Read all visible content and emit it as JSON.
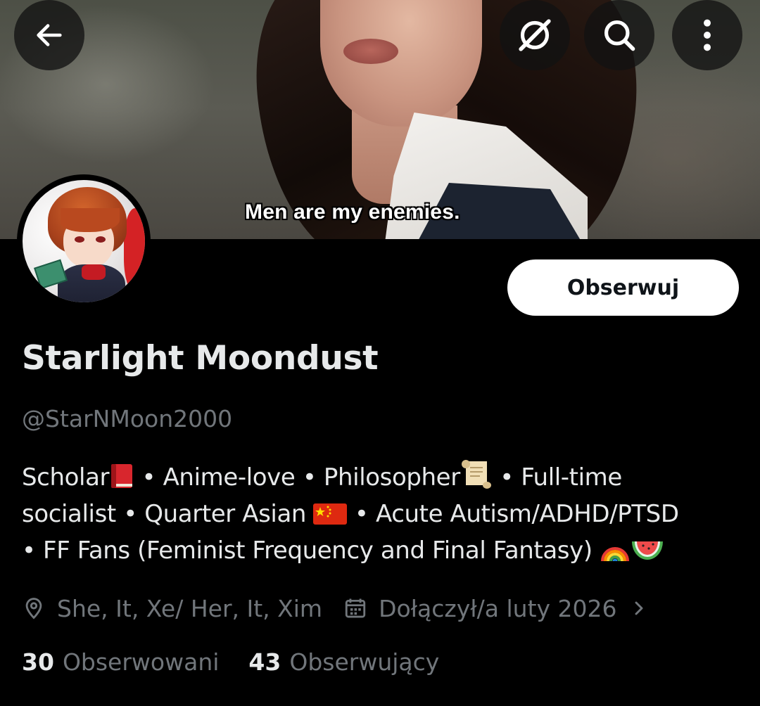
{
  "banner": {
    "caption": "Men are my enemies."
  },
  "top_bar": {
    "back_icon": "arrow-left-icon",
    "grok_icon": "grok-icon",
    "search_icon": "search-icon",
    "more_icon": "more-vertical-icon"
  },
  "profile": {
    "display_name": "Starlight Moondust",
    "handle": "@StarNMoon2000",
    "follow_label": "Obserwuj",
    "bio": {
      "scholar": "Scholar",
      "seg_anime": " • Anime-love • ",
      "philosopher": "Philosopher",
      "seg_fulltime": " • Full-time",
      "line2_a": "socialist • Quarter Asian ",
      "line2_b": " • Acute Autism/ADHD/PTSD",
      "line3": "• FF Fans (Feminist Frequency and Final Fantasy) "
    },
    "location": "She, It, Xe/ Her, It, Xim",
    "joined": "Dołączył/a luty 2026",
    "following_count": "30",
    "following_label": "Obserwowani",
    "followers_count": "43",
    "followers_label": "Obserwujący"
  },
  "colors": {
    "background": "#000000",
    "primary_text": "#e7e9ea",
    "secondary_text": "#71767b",
    "follow_button_bg": "#ffffff",
    "follow_button_text": "#0f1419"
  }
}
